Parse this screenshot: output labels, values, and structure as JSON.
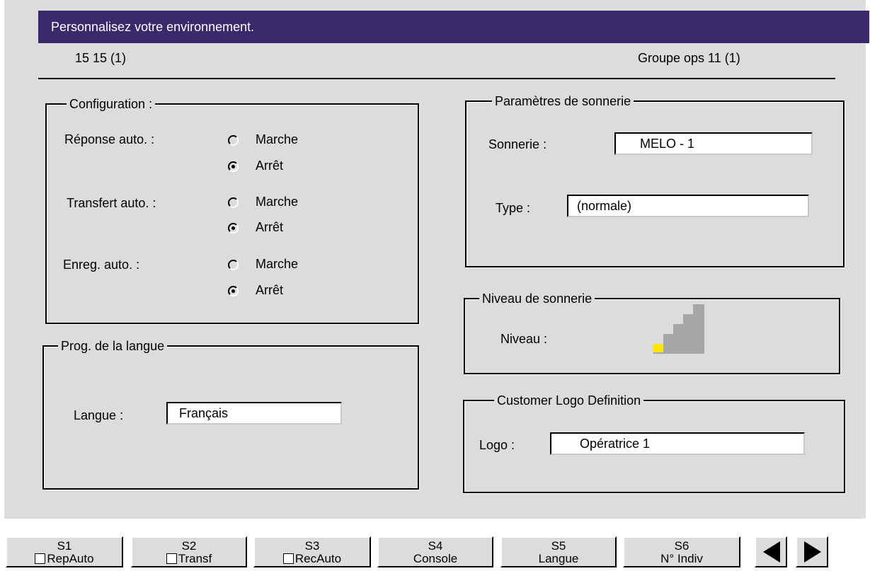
{
  "title": "Personnalisez votre environnement.",
  "header": {
    "left": "15 15 (1)",
    "right": "Groupe ops 11 (1)"
  },
  "config": {
    "legend": "Configuration :",
    "rows": [
      {
        "label": "Réponse auto. :",
        "on": "Marche",
        "off": "Arrêt",
        "selected": "off"
      },
      {
        "label": "Transfert auto. :",
        "on": "Marche",
        "off": "Arrêt",
        "selected": "off"
      },
      {
        "label": "Enreg. auto. :",
        "on": "Marche",
        "off": "Arrêt",
        "selected": "off"
      }
    ]
  },
  "langue": {
    "legend": "Prog. de la langue",
    "label": "Langue :",
    "value": "Français"
  },
  "sonnerie": {
    "legend": "Paramètres de sonnerie",
    "ring_label": "Sonnerie :",
    "ring_value": "MELO - 1",
    "type_label": "Type :",
    "type_value": "(normale)"
  },
  "niveau": {
    "legend": "Niveau de sonnerie",
    "label": "Niveau :",
    "level": 1,
    "max": 5,
    "active_color": "#ffe600"
  },
  "logo": {
    "legend": "Customer Logo Definition",
    "label": "Logo :",
    "value": "Opératrice 1"
  },
  "softkeys": [
    {
      "key": "S1",
      "label": "RepAuto",
      "checkbox": true
    },
    {
      "key": "S2",
      "label": "Transf",
      "checkbox": true
    },
    {
      "key": "S3",
      "label": "RecAuto",
      "checkbox": true
    },
    {
      "key": "S4",
      "label": "Console",
      "checkbox": false
    },
    {
      "key": "S5",
      "label": "Langue",
      "checkbox": false
    },
    {
      "key": "S6",
      "label": "N° Indiv",
      "checkbox": false
    }
  ],
  "colors": {
    "titlebar": "#3b2a6b",
    "panel": "#dcdcdc",
    "level_bar": "#a7a7a7"
  },
  "icons": [
    "arrow-left-icon",
    "arrow-right-icon"
  ]
}
